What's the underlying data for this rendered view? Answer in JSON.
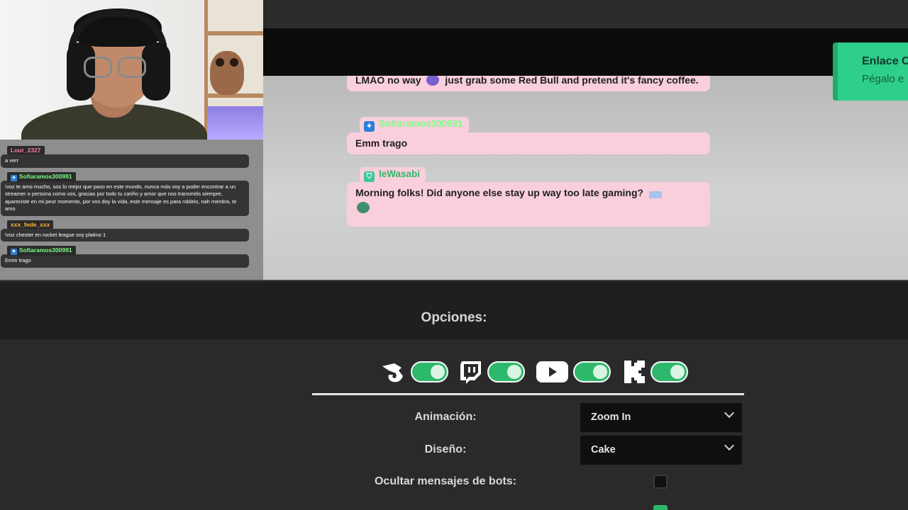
{
  "chat_overlay": {
    "messages": [
      {
        "user": "Lour_2327",
        "color": "#ff7aa8",
        "badge": "",
        "text": "a verr"
      },
      {
        "user": "Sofiaramos300991",
        "color": "#7dff8a",
        "badge": "prime",
        "text": "!voz te amo mucho, sos lo mejor que paso en este mundo, nunca más voy a poder encontrar a un streamer o persona como vos, gracias por todo tu cariño y amor que nos transmitis siempre, apareciste en mi peor momento, por vos doy la vida, este mensaje es para robleis, nah mentira, te amo"
      },
      {
        "user": "xxx_fede_xxx",
        "color": "#ffb13d",
        "badge": "",
        "text": "!voz chester en rocket league soy platino 1"
      },
      {
        "user": "Sofiaramos300991",
        "color": "#7dff8a",
        "badge": "prime",
        "text": "Emm trago"
      }
    ]
  },
  "toast": {
    "title": "Enlace C",
    "subtitle": "Pégalo e"
  },
  "preview": {
    "message_1": "LMAO no way",
    "message_1b": "just grab some Red Bull and pretend it's fancy coffee.",
    "user_2": "Sofiaramos300991",
    "message_2": "Emm trago",
    "user_3": "leWasabi",
    "message_3": "Morning folks! Did anyone else stay up way too late gaming?"
  },
  "options": {
    "title": "Opciones:",
    "platforms": [
      {
        "name": "Kick-style chat",
        "icon": "chameleon-icon",
        "enabled": true
      },
      {
        "name": "Twitch",
        "icon": "twitch-icon",
        "enabled": true
      },
      {
        "name": "YouTube",
        "icon": "youtube-icon",
        "enabled": true
      },
      {
        "name": "Kick",
        "icon": "kick-icon",
        "enabled": true
      }
    ],
    "animation_label": "Animación:",
    "animation_value": "Zoom In",
    "design_label": "Diseño:",
    "design_value": "Cake",
    "hide_bots_label": "Ocultar mensajes de bots:",
    "hide_bots_checked": false,
    "next_label_partial": "",
    "next_checked": true
  },
  "colors": {
    "accent_green": "#2eb86b",
    "bubble_pink": "#f9cfdc",
    "toast_green": "#2ecf8a"
  }
}
